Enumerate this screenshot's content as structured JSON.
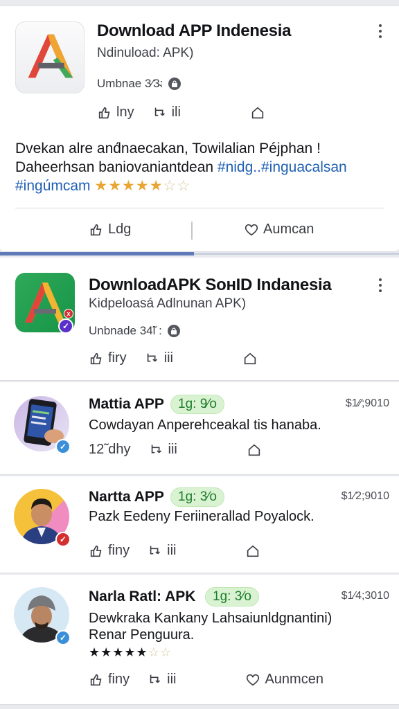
{
  "post1": {
    "title": "Download APP Indenesia",
    "subtitle": "Ndinuload: APK)",
    "meta": "Umbnae 3⁄3̴:",
    "actions": {
      "like": "lny",
      "repost": "ili"
    },
    "text_line1": "Dvekan alre and́naecakan, Towilalian Péjphan !",
    "text_line2_plain": "Daheerhsan baniovaniantdean ",
    "hashtag1": "#nidg..",
    "hashtag2": "#inguacalsan",
    "hashtag3": "#ingúmcam",
    "stars": "★★★★★",
    "stars_half": "☆☆",
    "footer_like": "Ldg",
    "footer_heart": "Aumcan"
  },
  "post2": {
    "title": "DownloadAPK SoнID Indanesia",
    "subtitle": "Kidpeloasá Adlnunan APK)",
    "meta": "Unbnade 34̃l :",
    "actions": {
      "like": "firy",
      "repost": "iii"
    }
  },
  "post3": {
    "name": "Mattia APP",
    "badge": "1g: 9⁄o",
    "price": "$1⁄⁄;9010",
    "line1": "Cowdayan Anperehceakal tis hanaba.",
    "actions": {
      "like": "dhy",
      "like_prefix": "12̃",
      "repost": "iii"
    }
  },
  "post4": {
    "name": "Nartta APP",
    "badge": "1g: 3⁄o",
    "price": "$1⁄2;9010",
    "line1": "Pazk Eedeny Feriinerallad Poyalock.",
    "actions": {
      "like": "finy",
      "repost": "iii"
    }
  },
  "post5": {
    "name": "Narla Ratl: APK",
    "badge": "1g: 3⁄o",
    "price": "$1⁄4;3010",
    "line1": "Dewkraka Kankany Lahsaiunldgnantini)",
    "line2": "Renar Penguura.",
    "stars": "★★★★★",
    "stars_half": "☆☆",
    "actions": {
      "like": "finy",
      "repost": "iii",
      "heart": "Aunmcen"
    }
  },
  "colors": {
    "accent_blue": "#5f7ab8",
    "hashtag": "#1f5fb3",
    "badge_green": "#1e7c2c",
    "star": "#e8a531",
    "verified_blue": "#3b8fd8",
    "verified_purple": "#5b2fc9",
    "verified_red": "#d32f2f"
  },
  "icons": [
    "more-vertical-icon",
    "like-thumb-icon",
    "repost-icon",
    "bookmark-icon",
    "heart-icon",
    "lock-icon",
    "verified-icon"
  ]
}
